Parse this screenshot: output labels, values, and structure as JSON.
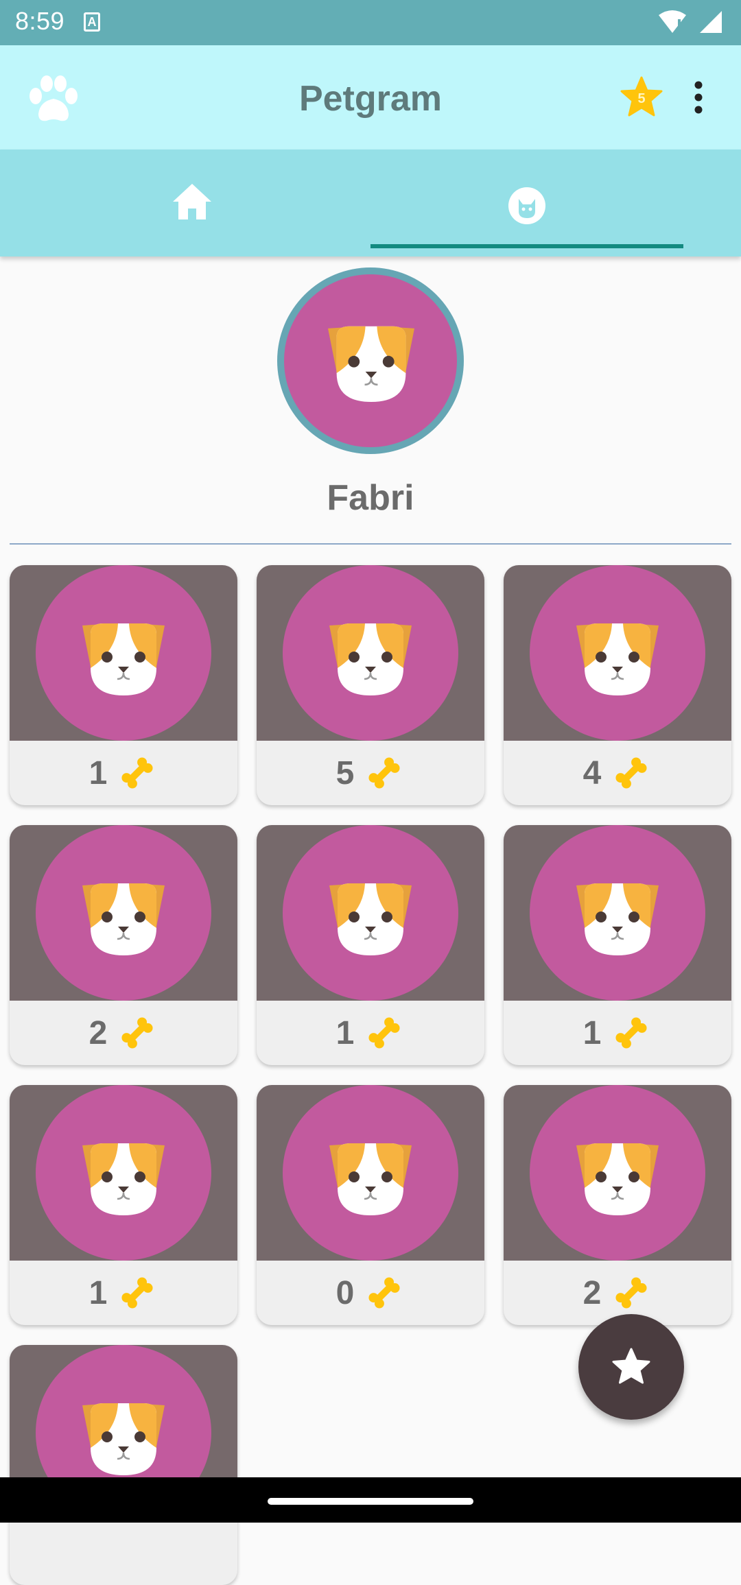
{
  "status_bar": {
    "time": "8:59",
    "notification_icon": "a-icon",
    "icons": [
      "wifi-alert-icon",
      "signal-icon"
    ]
  },
  "app_bar": {
    "title": "Petgram",
    "left_icon": "paw-icon",
    "badge_text": "5",
    "badge_icon": "star-icon",
    "menu_icon": "more-vert-icon"
  },
  "tabs": [
    {
      "name": "home",
      "icon": "home-icon",
      "selected": false
    },
    {
      "name": "profile",
      "icon": "cat-face-icon",
      "selected": true
    }
  ],
  "profile": {
    "name": "Fabri",
    "avatar": "dog-face-icon"
  },
  "posts": [
    {
      "likes": "1"
    },
    {
      "likes": "5"
    },
    {
      "likes": "4"
    },
    {
      "likes": "2"
    },
    {
      "likes": "1"
    },
    {
      "likes": "1"
    },
    {
      "likes": "1"
    },
    {
      "likes": "0"
    },
    {
      "likes": "2"
    },
    {
      "likes": ""
    }
  ],
  "fab": {
    "icon": "star-icon"
  },
  "colors": {
    "status_bar": "#63aeb5",
    "app_bar": "#bff7fb",
    "tab_bar": "#95e0e7",
    "indicator": "#138a80",
    "card_photo_bg": "#76696b",
    "photo_circle": "#c25a9e",
    "bone": "#ffc40c",
    "fab": "#4a3c3f"
  }
}
